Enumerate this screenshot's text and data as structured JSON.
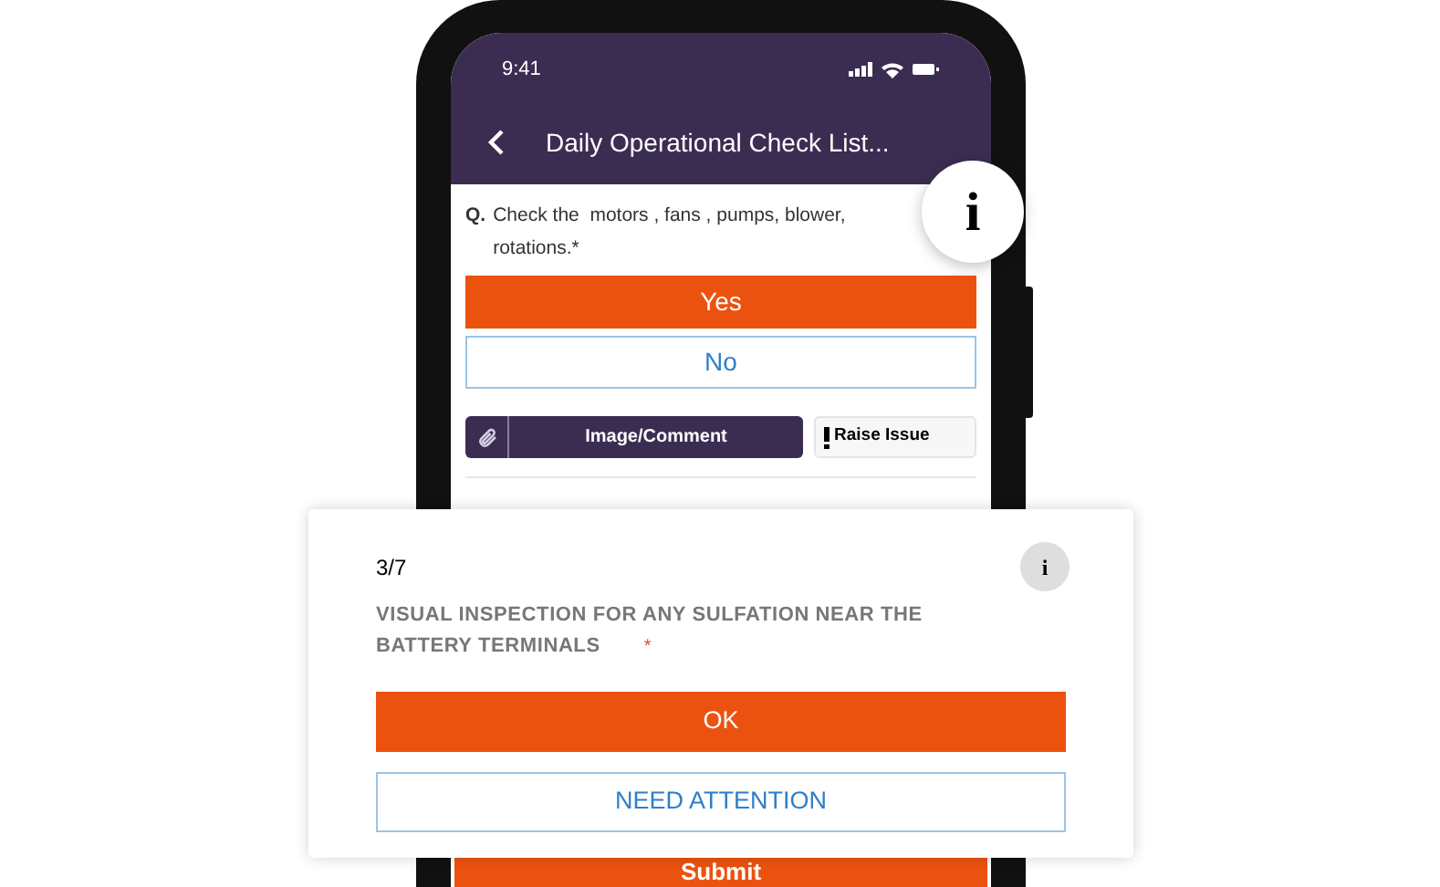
{
  "status_bar": {
    "time": "9:41"
  },
  "header": {
    "title": "Daily Operational Check List..."
  },
  "question": {
    "prefix": "Q.",
    "text": "Check the  motors , fans , pumps, blower, rotations.*",
    "options": [
      {
        "label": "Yes",
        "selected": true
      },
      {
        "label": "No",
        "selected": false
      }
    ],
    "actions": [
      {
        "kind": "attach",
        "label": "Image/Comment"
      },
      {
        "kind": "issue",
        "label": "Raise Issue"
      }
    ]
  },
  "submit": {
    "label": "Submit"
  },
  "info_badge": {
    "label": "i"
  },
  "card": {
    "progress": "3/7",
    "info": "i",
    "title": "VISUAL INSPECTION FOR ANY SULFATION NEAR THE BATTERY TERMINALS",
    "required_mark": "*",
    "options": [
      {
        "label": "OK",
        "selected": true
      },
      {
        "label": "NEED ATTENTION",
        "selected": false
      }
    ]
  }
}
